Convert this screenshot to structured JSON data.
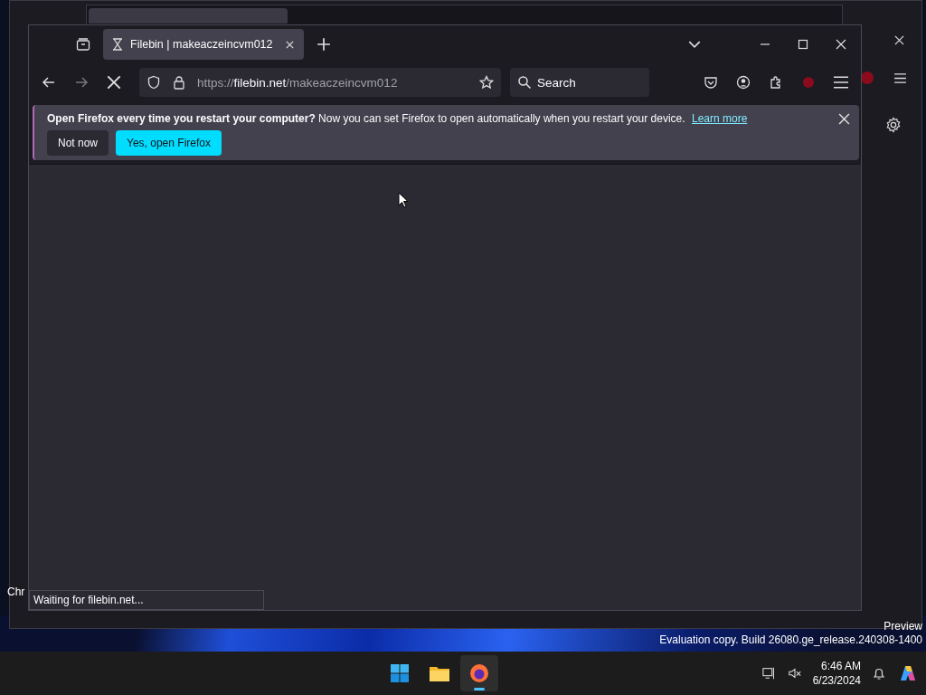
{
  "desktop": {
    "icon_label": "Chr",
    "watermark": [
      "Preview",
      "Evaluation copy. Build 26080.ge_release.240308-1400"
    ]
  },
  "window": {
    "tabs": [
      {
        "title": "Filebin | makeaczeincvm012",
        "selected": true
      }
    ],
    "url": {
      "scheme": "https://",
      "host": "filebin.net",
      "path": "/makeaczeincvm012"
    },
    "loading": true,
    "search": {
      "placeholder": "Search"
    },
    "notification": {
      "title": "Open Firefox every time you restart your computer?",
      "message": "Now you can set Firefox to open automatically when you restart your device.",
      "link": "Learn more",
      "buttons": [
        {
          "label": "Not now",
          "kind": "secondary"
        },
        {
          "label": "Yes, open Firefox",
          "kind": "primary"
        }
      ]
    },
    "status": "Waiting for filebin.net..."
  },
  "taskbar": {
    "apps": [
      {
        "kind": "start",
        "selected": false
      },
      {
        "kind": "folder",
        "selected": false
      },
      {
        "kind": "browser",
        "selected": true
      }
    ],
    "time": "6:46 AM",
    "date": "6/23/2024"
  }
}
